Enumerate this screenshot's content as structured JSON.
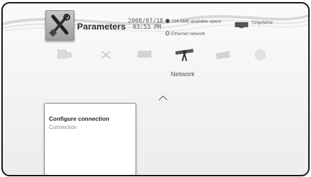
{
  "header": {
    "title": "Parameters",
    "date": "2008/07/18",
    "time": "03:53 PM",
    "icon": "tools-icon"
  },
  "status": {
    "space": "724.5MB available space",
    "network": "Ethernet network",
    "resolution": "720p/50Hz"
  },
  "categories": [
    {
      "name": "general",
      "icon": "console-icon"
    },
    {
      "name": "tools",
      "icon": "tools-icon"
    },
    {
      "name": "display",
      "icon": "display-icon"
    },
    {
      "name": "network",
      "icon": "satellite-icon",
      "label": "Network",
      "selected": true
    },
    {
      "name": "keyboard",
      "icon": "keyboard-icon"
    },
    {
      "name": "info",
      "icon": "info-icon"
    }
  ],
  "menu": {
    "title": "Configure connection",
    "subtitle": "Connection"
  }
}
